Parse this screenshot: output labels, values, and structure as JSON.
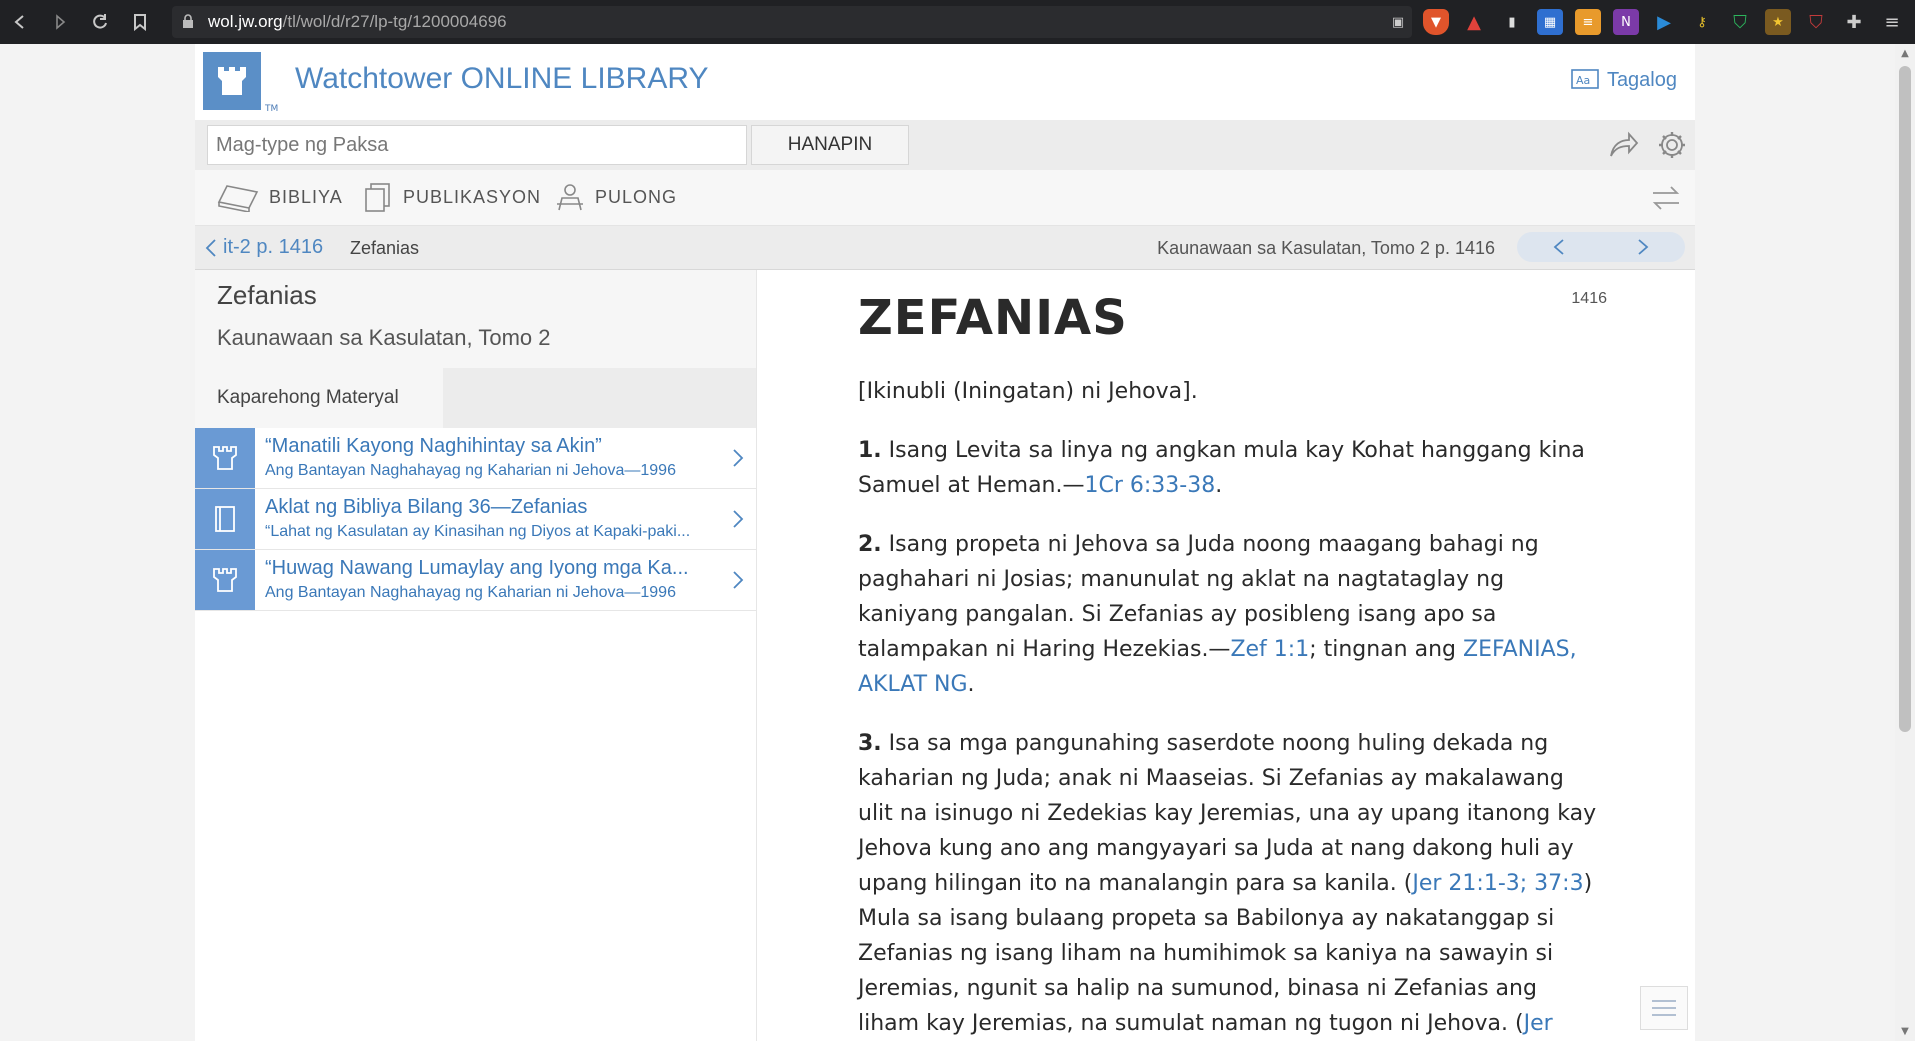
{
  "browser": {
    "url_host": "wol.jw.org",
    "url_path": "/tl/wol/d/r27/lp-tg/1200004696"
  },
  "header": {
    "site_title": "Watchtower ONLINE LIBRARY",
    "logo_tm": "TM",
    "language": "Tagalog"
  },
  "search": {
    "placeholder": "Mag-type ng Paksa",
    "button_label": "HANAPIN"
  },
  "nav": {
    "items": [
      {
        "label": "BIBLIYA"
      },
      {
        "label": "PUBLIKASYON"
      },
      {
        "label": "PULONG"
      }
    ]
  },
  "breadcrumb": {
    "back_label": "it-2 p. 1416",
    "current": "Zefanias",
    "publication": "Kaunawaan sa Kasulatan, Tomo 2 p. 1416"
  },
  "sidebar": {
    "title": "Zefanias",
    "subtitle": "Kaunawaan sa Kasulatan, Tomo 2",
    "tab_label": "Kaparehong Materyal",
    "related": [
      {
        "title": "“Manatili Kayong Naghihintay sa Akin”",
        "source": "Ang Bantayan Naghahayag ng Kaharian ni Jehova—1996"
      },
      {
        "title": "Aklat ng Bibliya Bilang 36—Zefanias",
        "source": "“Lahat ng Kasulatan ay Kinasihan ng Diyos at Kapaki-paki..."
      },
      {
        "title": "“Huwag Nawang Lumaylay ang Iyong mga Ka...",
        "source": "Ang Bantayan Naghahayag ng Kaharian ni Jehova—1996"
      }
    ]
  },
  "article": {
    "page_number": "1416",
    "title": "ZEFANIAS",
    "intro": "[Ikinubli (Iningatan) ni Jehova].",
    "p1_num": "1.",
    "p1_text": " Isang Levita sa linya ng angkan mula kay Kohat hanggang kina Samuel at Heman.—",
    "p1_link": "1Cr 6:33-38",
    "p1_end": ".",
    "p2_num": "2.",
    "p2_text": " Isang propeta ni Jehova sa Juda noong maagang bahagi ng paghahari ni Josias; manunulat ng aklat na nagtataglay ng kaniyang pangalan. Si Zefanias ay posibleng isang apo sa talampakan ni Haring Hezekias.—",
    "p2_link1": "Zef 1:1",
    "p2_mid": "; tingnan ang ",
    "p2_link2": "ZEFANIAS, AKLAT NG",
    "p2_end": ".",
    "p3_num": "3.",
    "p3_text": " Isa sa mga pangunahing saserdote noong huling dekada ng kaharian ng Juda; anak ni Maaseias. Si Zefanias ay makalawang ulit na isinugo ni Zedekias kay Jeremias, una ay upang itanong kay Jehova kung ano ang mangyayari sa Juda at nang dakong huli ay upang hilingan ito na manalangin para sa kanila. (",
    "p3_link1": "Jer 21:1-3; 37:3",
    "p3_mid": ") Mula sa isang bulaang propeta sa Babilonya ay nakatanggap si Zefanias ng isang liham na humihimok sa kaniya na sawayin si Jeremias, ngunit sa halip na sumunod, binasa ni Zefanias ang liham kay Jeremias, na sumulat naman ng tugon ni Jehova. (",
    "p3_link2": "Jer"
  },
  "colors": {
    "brand_blue": "#4f87c1",
    "link_blue": "#3a78b8",
    "icon_bg": "#6a9ad4"
  }
}
